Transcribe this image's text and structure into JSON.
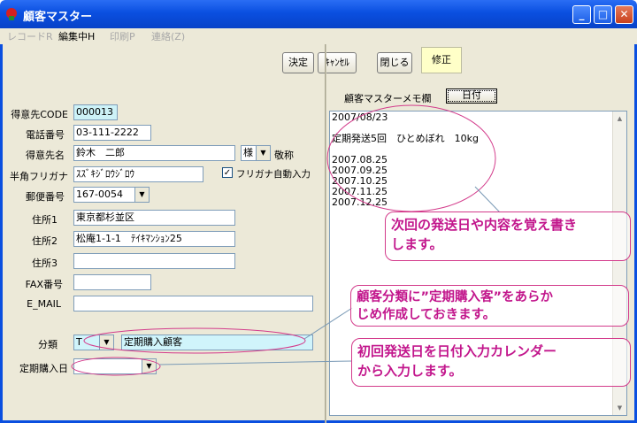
{
  "window": {
    "title": "顧客マスター",
    "controls": {
      "minimize": "_",
      "maximize": "□",
      "close": "✕"
    }
  },
  "menu": {
    "record": "レコードR",
    "edit": "編集中H",
    "print": "印刷P",
    "link": "連絡(Z)"
  },
  "toolbar": {
    "confirm": "決定",
    "cancel": "ｷｬﾝｾﾙ",
    "close": "閉じる",
    "edit": "修正"
  },
  "form": {
    "code_label": "得意先CODE",
    "code_value": "000013",
    "phone_label": "電話番号",
    "phone_value": "03-111-2222",
    "name_label": "得意先名",
    "name_value": "鈴木　二郎",
    "honorific_value": "様",
    "honorific_label": "敬称",
    "kana_label": "半角フリガナ",
    "kana_value": "ｽｽﾞｷｼﾞﾛｳｼﾞﾛｳ",
    "auto_kana_label": "フリガナ自動入力",
    "auto_kana_checked": true,
    "zip_label": "郵便番号",
    "zip_value": "167-0054",
    "addr1_label": "住所1",
    "addr1_value": "東京都杉並区",
    "addr2_label": "住所2",
    "addr2_value": "松庵1-1-1　ﾃｲｷﾏﾝｼｮﾝ25",
    "addr3_label": "住所3",
    "addr3_value": "",
    "fax_label": "FAX番号",
    "fax_value": "",
    "email_label": "E_MAIL",
    "email_value": "",
    "category_label": "分類",
    "category_code": "T",
    "category_name": "定期購入顧客",
    "regular_date_label": "定期購入日",
    "regular_date_value": ""
  },
  "memo": {
    "title": "顧客マスターメモ欄",
    "date_button": "日付",
    "text": "2007/08/23\n\n定期発送5回　ひとめぼれ　10kg\n\n2007.08.25\n2007.09.25\n2007.10.25\n2007.11.25\n2007.12.25"
  },
  "callouts": {
    "memo_note": "次回の発送日や内容を覚え書き\nします。",
    "category_note": "顧客分類に”定期購入客”をあらか\nじめ作成しておきます。",
    "date_note": "初回発送日を日付入力カレンダー\nから入力します。"
  },
  "colors": {
    "titlebar": "#0a4fe0",
    "callout": "#d33b8b",
    "edit_button_bg": "#ffffc8",
    "code_field_bg": "#cdf2f7"
  }
}
